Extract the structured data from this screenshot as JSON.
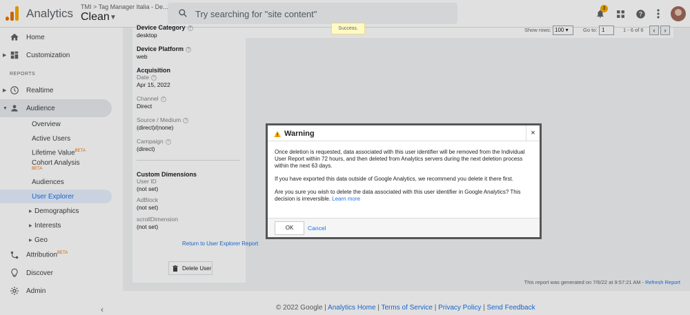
{
  "header": {
    "app_name": "Analytics",
    "account_path": "TMI > Tag Manager Italia - De...",
    "view_name": "Clean",
    "search_placeholder": "Try searching for \"site content\"",
    "notifications_count": "3"
  },
  "sidebar": {
    "home": "Home",
    "customization": "Customization",
    "reports_label": "REPORTS",
    "realtime": "Realtime",
    "audience": "Audience",
    "audience_items": {
      "overview": "Overview",
      "active_users": "Active Users",
      "lifetime_value": "Lifetime Value",
      "cohort_analysis": "Cohort Analysis",
      "audiences": "Audiences",
      "user_explorer": "User Explorer",
      "demographics": "Demographics",
      "interests": "Interests",
      "geo": "Geo"
    },
    "beta": "BETA",
    "attribution": "Attribution",
    "discover": "Discover",
    "admin": "Admin"
  },
  "details": {
    "device_category_label": "Device Category",
    "device_category_value": "desktop",
    "device_platform_label": "Device Platform",
    "device_platform_value": "web",
    "acquisition_label": "Acquisition",
    "date_label": "Date",
    "date_value": "Apr 15, 2022",
    "channel_label": "Channel",
    "channel_value": "Direct",
    "source_label": "Source / Medium",
    "source_value": "(direct)/(none)",
    "campaign_label": "Campaign",
    "campaign_value": "(direct)",
    "custom_dimensions_label": "Custom Dimensions",
    "user_id_label": "User ID",
    "user_id_value": "(not set)",
    "adblock_label": "AdBlock",
    "adblock_value": "(not set)",
    "scroll_label": "scrollDimension",
    "scroll_value": "(not set)",
    "return_link": "Return to User Explorer Report",
    "delete_user": "Delete User"
  },
  "table_controls": {
    "show_rows_label": "Show rows:",
    "show_rows_value": "100",
    "goto_label": "Go to:",
    "goto_value": "1",
    "range": "1 - 6 of 6"
  },
  "report": {
    "generated_text": "This report was generated on 7/6/22 at 9:57:21 AM - ",
    "refresh_link": "Refresh Report"
  },
  "footer": {
    "copyright": "© 2022 Google",
    "analytics_home": "Analytics Home",
    "terms": "Terms of Service",
    "privacy": "Privacy Policy",
    "feedback": "Send Feedback",
    "separator": " | "
  },
  "toast": "Success.",
  "dialog": {
    "title": "Warning",
    "close": "×",
    "para1": "Once deletion is requested, data associated with this user identifier will be removed from the Individual User Report within 72 hours, and then deleted from Analytics servers during the next deletion process within the next 63 days.",
    "para2": "If you have exported this data outside of Google Analytics, we recommend you delete it there first.",
    "para3": "Are you sure you wish to delete the data associated with this user identifier in Google Analytics? This decision is irreversible. ",
    "learn_more": "Learn more",
    "ok": "OK",
    "cancel": "Cancel"
  }
}
